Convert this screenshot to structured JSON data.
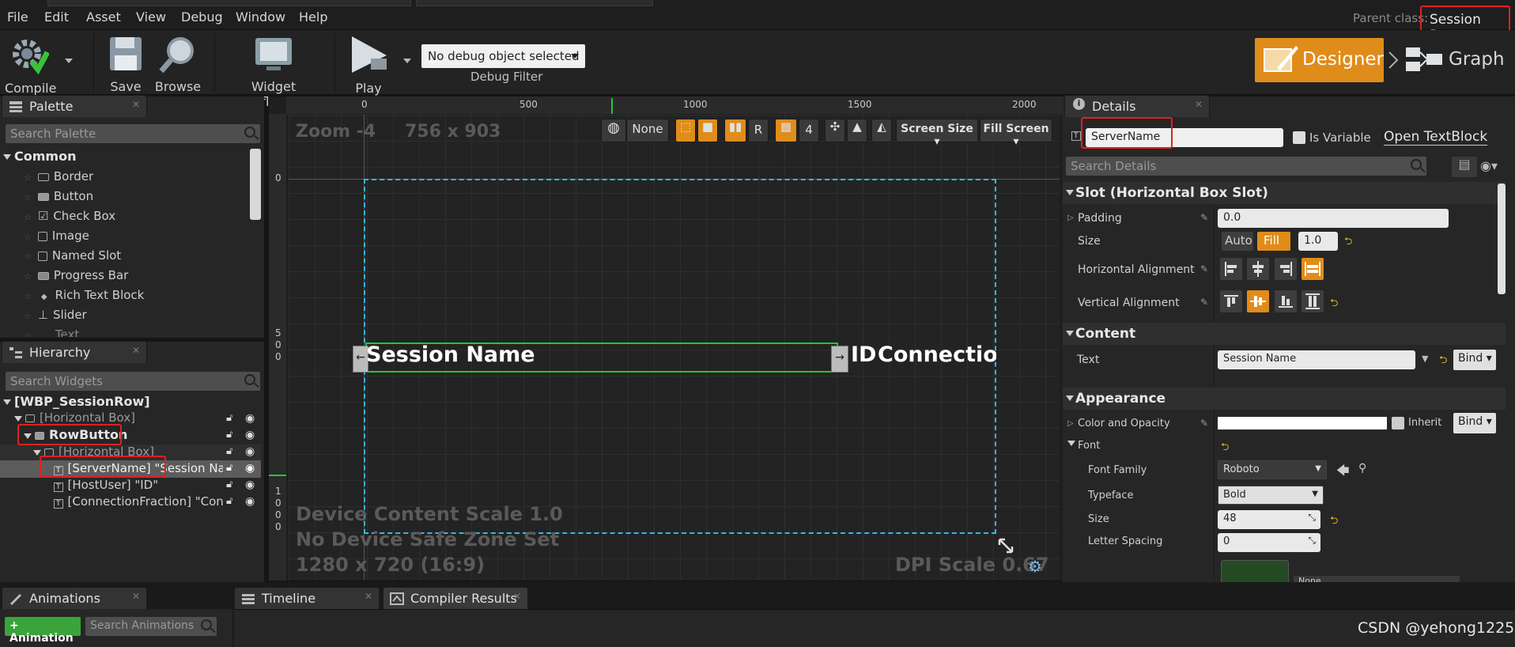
{
  "menu": [
    "File",
    "Edit",
    "Asset",
    "View",
    "Debug",
    "Window",
    "Help"
  ],
  "header": {
    "parent_class_label": "Parent class:",
    "parent_class_value": "Session Row"
  },
  "toolbar": {
    "compile": "Compile",
    "save": "Save",
    "browse": "Browse",
    "widget_reflector": "Widget Reflector",
    "play": "Play",
    "debug_select": "No debug object selected",
    "debug_filter": "Debug Filter",
    "designer": "Designer",
    "graph": "Graph"
  },
  "palette": {
    "tab": "Palette",
    "search_placeholder": "Search Palette",
    "category": "Common",
    "items": [
      "Border",
      "Button",
      "Check Box",
      "Image",
      "Named Slot",
      "Progress Bar",
      "Rich Text Block",
      "Slider",
      "Text"
    ]
  },
  "hierarchy": {
    "tab": "Hierarchy",
    "search_placeholder": "Search Widgets",
    "root": "[WBP_SessionRow]",
    "items": [
      "[Horizontal Box]",
      "RowButton",
      "[Horizontal Box]",
      "[ServerName] \"Session Name",
      "[HostUser] \"ID\"",
      "[ConnectionFraction] \"Conne"
    ]
  },
  "canvas": {
    "zoom": "Zoom -4",
    "size": "756 x 903",
    "ruler_top": [
      "0",
      "500",
      "1000",
      "1500",
      "2000"
    ],
    "ruler_left_a": [
      "0"
    ],
    "ruler_left_b": [
      "5",
      "0",
      "0"
    ],
    "ruler_left_c": [
      "1",
      "0",
      "0",
      "0"
    ],
    "session_name": "Session Name",
    "id_text": "ID",
    "connections": "Connections",
    "scale_text": "Device Content Scale 1.0",
    "safe_zone": "No Device Safe Zone Set",
    "resolution": "1280 x 720 (16:9)",
    "dpi": "DPI Scale 0.67",
    "vp_none": "None",
    "vp_r": "R",
    "vp_grid_num": "4",
    "vp_screen_size": "Screen Size",
    "vp_fill_screen": "Fill Screen"
  },
  "details": {
    "tab": "Details",
    "name_value": "ServerName",
    "is_variable": "Is Variable",
    "open_textblock": "Open TextBlock",
    "search_placeholder": "Search Details",
    "slot_section": "Slot (Horizontal Box Slot)",
    "padding_label": "Padding",
    "padding_value": "0.0",
    "size_label": "Size",
    "size_auto": "Auto",
    "size_fill": "Fill",
    "size_value": "1.0",
    "halign_label": "Horizontal Alignment",
    "valign_label": "Vertical Alignment",
    "content_section": "Content",
    "text_label": "Text",
    "text_value": "Session Name",
    "bind": "Bind",
    "appearance_section": "Appearance",
    "color_label": "Color and Opacity",
    "inherit": "Inherit",
    "font_label": "Font",
    "font_family_label": "Font Family",
    "font_family_value": "Roboto",
    "typeface_label": "Typeface",
    "typeface_value": "Bold",
    "font_size_label": "Size",
    "font_size_value": "48",
    "letter_spacing_label": "Letter Spacing",
    "letter_spacing_value": "0",
    "none_value": "None"
  },
  "bottom": {
    "animations_tab": "Animations",
    "add_animation": "+ Animation",
    "search_animations": "Search Animations",
    "timeline_tab": "Timeline",
    "compiler_tab": "Compiler Results",
    "watermark": "CSDN @yehong1225"
  },
  "colors": {
    "accent": "#e08c1a",
    "highlight_red": "#e02020",
    "selection_blue": "#3ab5e8",
    "green": "#23c832"
  }
}
